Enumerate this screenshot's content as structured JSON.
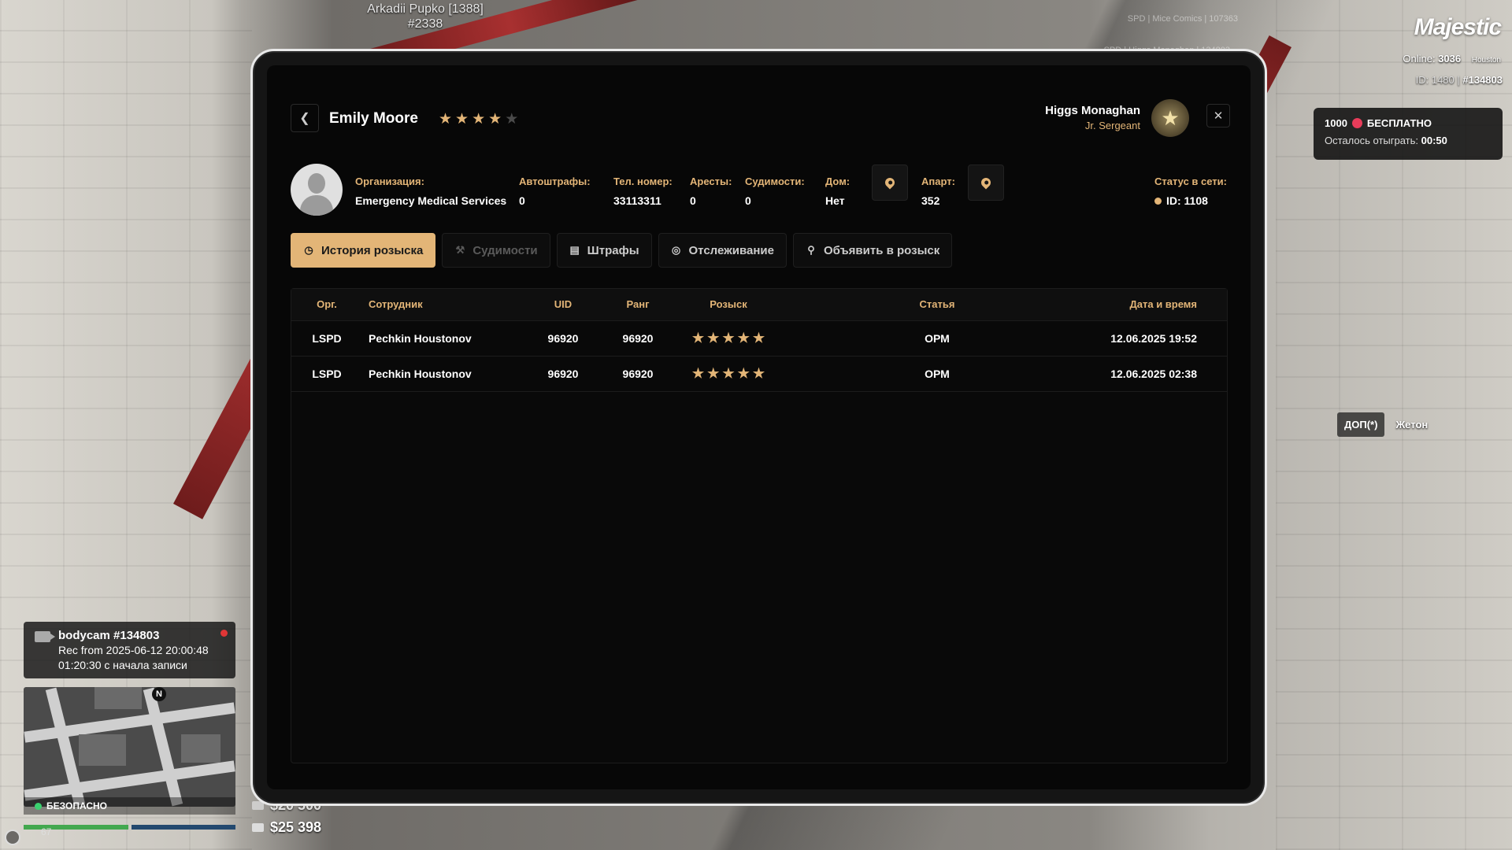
{
  "player_tag": {
    "name": "Arkadii Pupko [1388]",
    "id": "#2338"
  },
  "faded_notices": [
    "SPD | Mice Comics | 107363",
    "SPD | Higgs Monaghan | 134803"
  ],
  "hud": {
    "brand": "Majestic",
    "online_label": "Online:",
    "online_count": "3036",
    "server": "Houston",
    "id_text": "ID: 1480 |",
    "id_hash": "#134803",
    "promo_amount": "1000",
    "promo_free": "БЕСПЛАТНО",
    "promo_remaining_label": "Осталось отыграть:",
    "promo_remaining_time": "00:50",
    "key_dop": "ДОП(*)",
    "key_token": "Жетон",
    "bodycam_title": "bodycam #134803",
    "bodycam_rec": "Rec from 2025-06-12 20:00:48",
    "bodycam_elapsed": "01:20:30 с начала записи",
    "safe_label": "БЕЗОПАСНО",
    "health": "67",
    "cash": "$20 500",
    "bank": "$25 398",
    "minimap_north": "N"
  },
  "tablet": {
    "person_name": "Emily Moore",
    "wanted_level": 4,
    "wanted_max": 5,
    "officer_name": "Higgs Monaghan",
    "officer_rank": "Jr. Sergeant",
    "info": {
      "org_label": "Организация:",
      "org_value": "Emergency Medical Services",
      "fines_label": "Автоштрафы:",
      "fines_value": "0",
      "phone_label": "Тел. номер:",
      "phone_value": "33113311",
      "arrests_label": "Аресты:",
      "arrests_value": "0",
      "convictions_label": "Судимости:",
      "convictions_value": "0",
      "house_label": "Дом:",
      "house_value": "Нет",
      "apart_label": "Апарт:",
      "apart_value": "352",
      "status_label": "Статус в сети:",
      "status_value": "ID: 1108"
    },
    "tabs": [
      {
        "label": "История розыска",
        "icon": "clock-icon"
      },
      {
        "label": "Судимости",
        "icon": "gavel-icon"
      },
      {
        "label": "Штрафы",
        "icon": "receipt-icon"
      },
      {
        "label": "Отслеживание",
        "icon": "tracking-icon"
      },
      {
        "label": "Объявить в розыск",
        "icon": "search-doc-icon"
      }
    ],
    "table": {
      "headers": [
        "Орг.",
        "Сотрудник",
        "UID",
        "Ранг",
        "Розыск",
        "Статья",
        "Дата и время"
      ],
      "rows": [
        {
          "org": "LSPD",
          "employee": "Pechkin Houstonov",
          "uid": "96920",
          "rank": "96920",
          "wanted": 5,
          "article": "ОРМ",
          "datetime": "12.06.2025 19:52"
        },
        {
          "org": "LSPD",
          "employee": "Pechkin Houstonov",
          "uid": "96920",
          "rank": "96920",
          "wanted": 5,
          "article": "ОРМ",
          "datetime": "12.06.2025 02:38"
        }
      ]
    }
  },
  "colors": {
    "accent": "#e3b577",
    "panel": "#070707",
    "safe": "#3bd16f",
    "rec": "#e03636"
  }
}
